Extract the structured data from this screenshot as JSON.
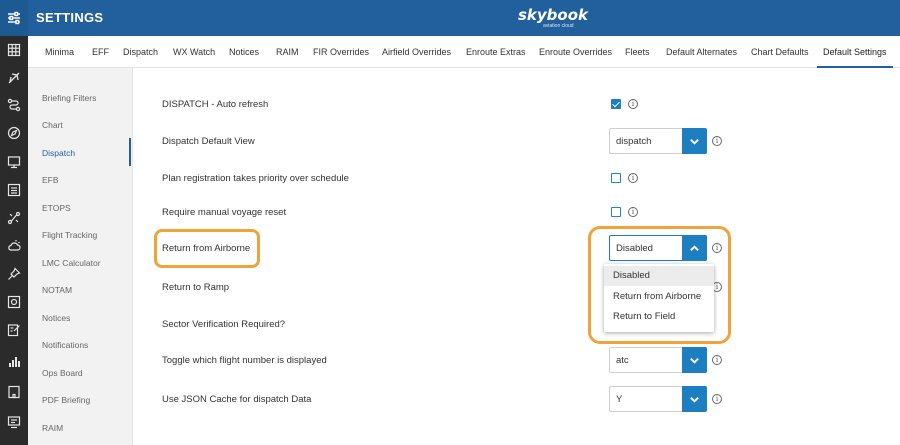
{
  "header": {
    "title": "SETTINGS",
    "brand": "skybook",
    "brand_sub": "aviation cloud"
  },
  "tabs": [
    {
      "label": "Minima"
    },
    {
      "label": "EFF"
    },
    {
      "label": "Dispatch"
    },
    {
      "label": "WX Watch"
    },
    {
      "label": "Notices"
    },
    {
      "label": "RAIM"
    },
    {
      "label": "FIR Overrides"
    },
    {
      "label": "Airfield Overrides"
    },
    {
      "label": "Enroute Extras"
    },
    {
      "label": "Enroute Overrides"
    },
    {
      "label": "Fleets"
    },
    {
      "label": "Default Alternates"
    },
    {
      "label": "Chart Defaults"
    },
    {
      "label": "Default Settings",
      "active": true
    }
  ],
  "sidebar": {
    "items": [
      {
        "label": "Briefing Filters"
      },
      {
        "label": "Chart"
      },
      {
        "label": "Dispatch",
        "active": true
      },
      {
        "label": "EFB"
      },
      {
        "label": "ETOPS"
      },
      {
        "label": "Flight Tracking"
      },
      {
        "label": "LMC Calculator"
      },
      {
        "label": "NOTAM"
      },
      {
        "label": "Notices"
      },
      {
        "label": "Notifications"
      },
      {
        "label": "Ops Board"
      },
      {
        "label": "PDF Briefing"
      },
      {
        "label": "RAIM"
      }
    ]
  },
  "settings": {
    "rows": [
      {
        "label": "DISPATCH - Auto refresh",
        "control": "checkbox",
        "checked": true
      },
      {
        "label": "Dispatch Default View",
        "control": "select",
        "value": "dispatch"
      },
      {
        "label": "Plan registration takes priority over schedule",
        "control": "checkbox",
        "checked": false
      },
      {
        "label": "Require manual voyage reset",
        "control": "checkbox",
        "checked": false
      },
      {
        "label": "Return from Airborne",
        "control": "select",
        "value": "Disabled",
        "open": true
      },
      {
        "label": "Return to Ramp",
        "control": "hidden"
      },
      {
        "label": "Sector Verification Required?",
        "control": "hidden"
      },
      {
        "label": "Toggle which flight number is displayed",
        "control": "select",
        "value": "atc"
      },
      {
        "label": "Use JSON Cache for dispatch Data",
        "control": "select",
        "value": "Y"
      }
    ],
    "dropdown_options": [
      "Disabled",
      "Return from Airborne",
      "Return to Field"
    ]
  },
  "icons": {
    "info_glyph": "i"
  },
  "colors": {
    "header": "#22609d",
    "rail": "#2b2b2b",
    "accent": "#1e7fc0",
    "highlight": "#f0a33a"
  }
}
